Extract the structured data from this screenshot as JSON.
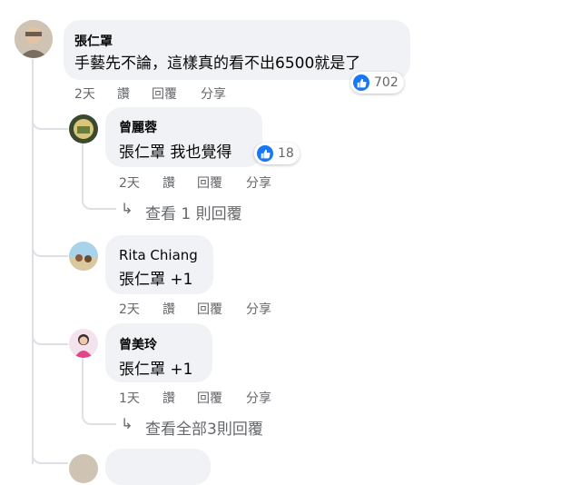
{
  "comments": [
    {
      "author": "張仁罩",
      "text": "手藝先不論，這樣真的看不出6500就是了",
      "reaction_count": "702",
      "time": "2天",
      "like": "讚",
      "reply": "回覆",
      "share": "分享"
    }
  ],
  "replies": [
    {
      "author": "曾麗蓉",
      "mention": "張仁罩",
      "text": " 我也覺得",
      "reaction_count": "18",
      "time": "2天",
      "like": "讚",
      "reply": "回覆",
      "share": "分享",
      "more": "查看 1 則回覆"
    },
    {
      "author": "Rita Chiang",
      "mention": "張仁罩",
      "text": " +1",
      "time": "2天",
      "like": "讚",
      "reply": "回覆",
      "share": "分享"
    },
    {
      "author": "曾美玲",
      "mention": "張仁罩",
      "text": " +1",
      "time": "1天",
      "like": "讚",
      "reply": "回覆",
      "share": "分享",
      "more": "查看全部3則回覆"
    }
  ],
  "colors": {
    "like_blue": "#1877f2",
    "bubble": "#f0f2f5",
    "meta": "#65676b"
  }
}
